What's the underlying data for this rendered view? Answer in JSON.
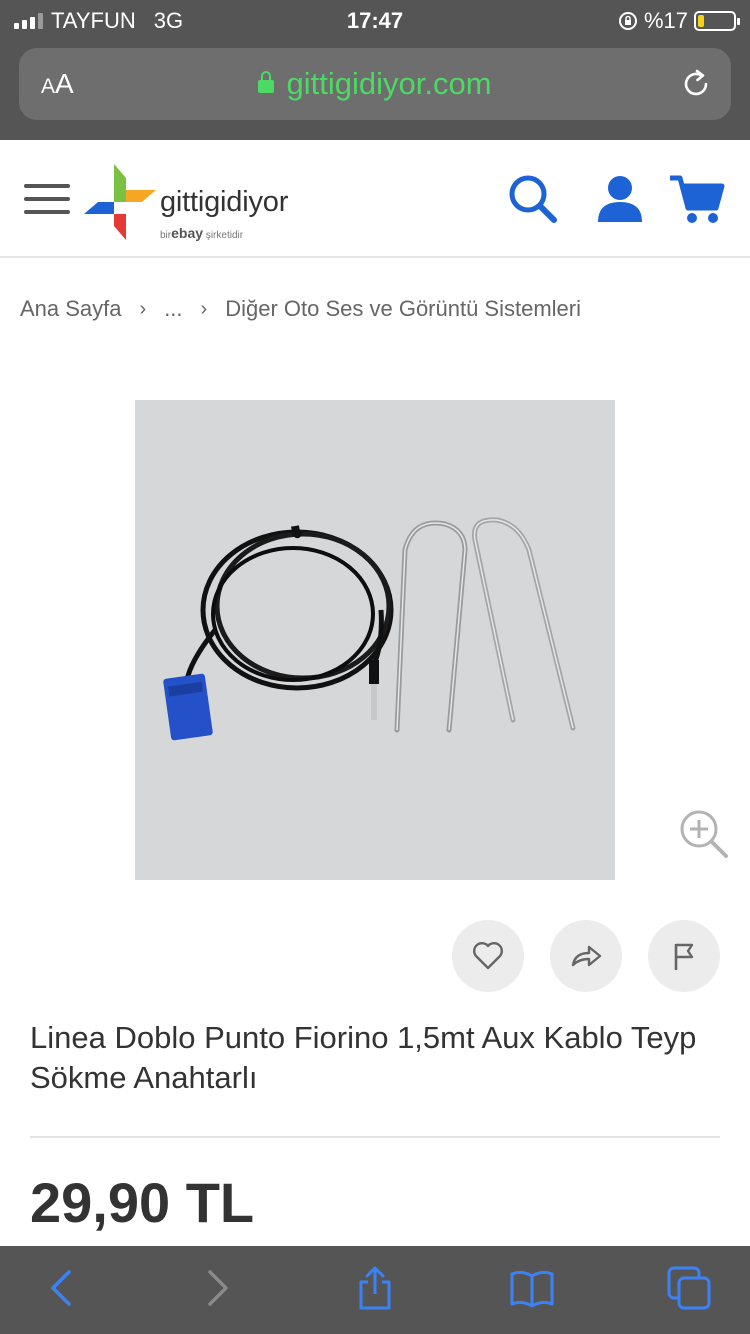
{
  "status_bar": {
    "carrier": "TAYFUN",
    "network": "3G",
    "time": "17:47",
    "battery_text": "%17",
    "battery_level": 0.17
  },
  "browser": {
    "text_size_label_small": "A",
    "text_size_label_large": "A",
    "url": "gittigidiyor.com",
    "url_color": "#4cd964"
  },
  "header": {
    "logo_text": "gittigidiyor",
    "logo_sub_pre": "bir",
    "logo_sub_brand": "ebay",
    "logo_sub_post": "şirketidir",
    "brand_blue": "#1e63d6",
    "icons": [
      "menu-icon",
      "search-icon",
      "user-icon",
      "cart-icon"
    ]
  },
  "breadcrumb": {
    "items": [
      "Ana Sayfa",
      "...",
      "Diğer Oto Ses ve Görüntü Sistemleri"
    ],
    "separator": "›"
  },
  "product": {
    "title": "Linea Doblo Punto Fiorino 1,5mt Aux Kablo Teyp Sökme Anahtarlı",
    "price": "29,90 TL",
    "actions": [
      "heart-icon",
      "share-icon",
      "flag-icon"
    ]
  },
  "toolbar": {
    "icons": [
      "back-icon",
      "forward-icon",
      "share-icon",
      "bookmarks-icon",
      "tabs-icon"
    ],
    "accent": "#3b82f6"
  }
}
